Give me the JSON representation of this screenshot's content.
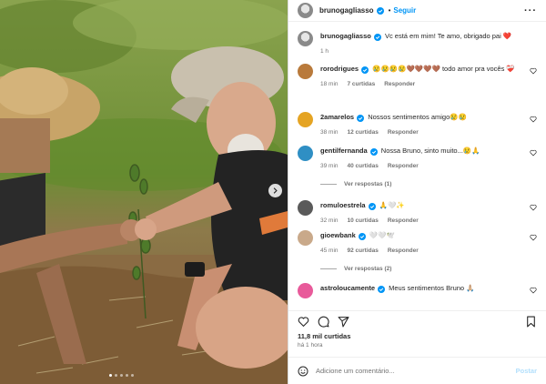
{
  "post": {
    "username": "brunogagliasso",
    "separator": "•",
    "follow_label": "Seguir",
    "more_label": "···",
    "caption": "Vc está em mim! Te amo, obrigado pai ❤️",
    "caption_time": "1 h"
  },
  "comments": [
    {
      "username": "rorodrigues",
      "verified": true,
      "text": "😢😢😢😢🤎🤎🤎🤎 todo amor pra vocês ❤️‍🩹",
      "time": "18 min",
      "likes": "7 curtidas",
      "reply": "Responder",
      "avatar_color": "#b97a3b"
    },
    {
      "username": "2amarelos",
      "verified": true,
      "text": "Nossos sentimentos amigo😢😢",
      "time": "38 min",
      "likes": "12 curtidas",
      "reply": "Responder",
      "avatar_color": "#e5a423"
    },
    {
      "username": "gentilfernanda",
      "verified": true,
      "text": "Nossa Bruno, sinto muito...😢🙏",
      "time": "39 min",
      "likes": "40 curtidas",
      "reply": "Responder",
      "avatar_color": "#2f8fc4",
      "view_replies": "Ver respostas (1)"
    },
    {
      "username": "romuloestrela",
      "verified": true,
      "text": "🙏🤍✨",
      "time": "32 min",
      "likes": "10 curtidas",
      "reply": "Responder",
      "avatar_color": "#5a5a5a"
    },
    {
      "username": "gioewbank",
      "verified": true,
      "text": "🤍🤍🕊️",
      "time": "45 min",
      "likes": "92 curtidas",
      "reply": "Responder",
      "avatar_color": "#c9a98a",
      "view_replies": "Ver respostas (2)"
    },
    {
      "username": "astroloucamente",
      "verified": true,
      "text": "Meus sentimentos Bruno 🙏🏼",
      "avatar_color": "#e85a9a"
    }
  ],
  "likes_count": "11,8 mil curtidas",
  "posted_ago": "há 1 hora",
  "comment_box": {
    "placeholder": "Adicione um comentário...",
    "post_label": "Postar"
  },
  "colors": {
    "accent": "#0095f6",
    "verified": "#0095f6",
    "muted": "#737373",
    "post_disabled": "#b2dffc"
  },
  "icons": [
    "heart-icon",
    "comment-icon",
    "share-icon",
    "save-icon",
    "emoji-icon",
    "chevron-right-icon",
    "verified-badge-icon"
  ]
}
